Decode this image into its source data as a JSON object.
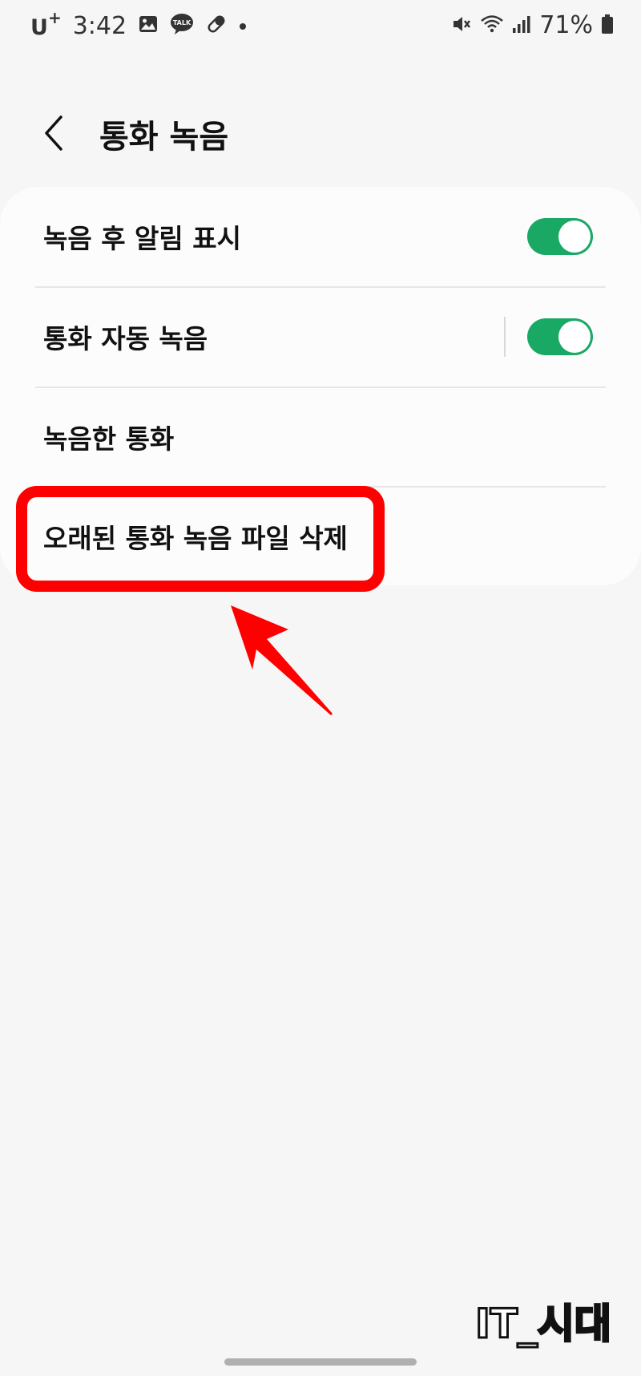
{
  "status_bar": {
    "carrier": "U",
    "carrier_plus": "+",
    "time": "3:42",
    "battery": "71%"
  },
  "header": {
    "title": "통화 녹음"
  },
  "settings": {
    "items": [
      {
        "label": "녹음 후 알림 표시",
        "toggle": true,
        "toggle_on": true
      },
      {
        "label": "통화 자동 녹음",
        "toggle": true,
        "toggle_on": true
      },
      {
        "label": "녹음한 통화"
      },
      {
        "label": "오래된 통화 녹음 파일 삭제"
      }
    ]
  },
  "watermark": {
    "text": "IT_시대"
  },
  "colors": {
    "toggle_on": "#1aa865",
    "highlight": "#ff0000",
    "background": "#f6f6f6",
    "card": "#fcfcfc"
  }
}
